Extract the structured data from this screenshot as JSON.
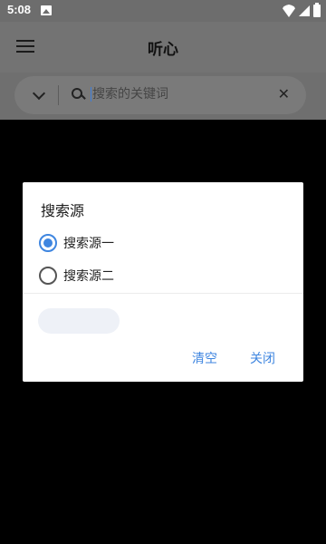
{
  "status_bar": {
    "time": "5:08"
  },
  "app_bar": {
    "title": "听心"
  },
  "search": {
    "placeholder": "搜索的关键词",
    "clear_symbol": "✕"
  },
  "dialog": {
    "title": "搜索源",
    "options": [
      {
        "label": "搜索源一",
        "selected": true
      },
      {
        "label": "搜索源二",
        "selected": false
      }
    ],
    "actions": {
      "clear": "清空",
      "close": "关闭"
    }
  },
  "colors": {
    "accent": "#3f86e0"
  }
}
